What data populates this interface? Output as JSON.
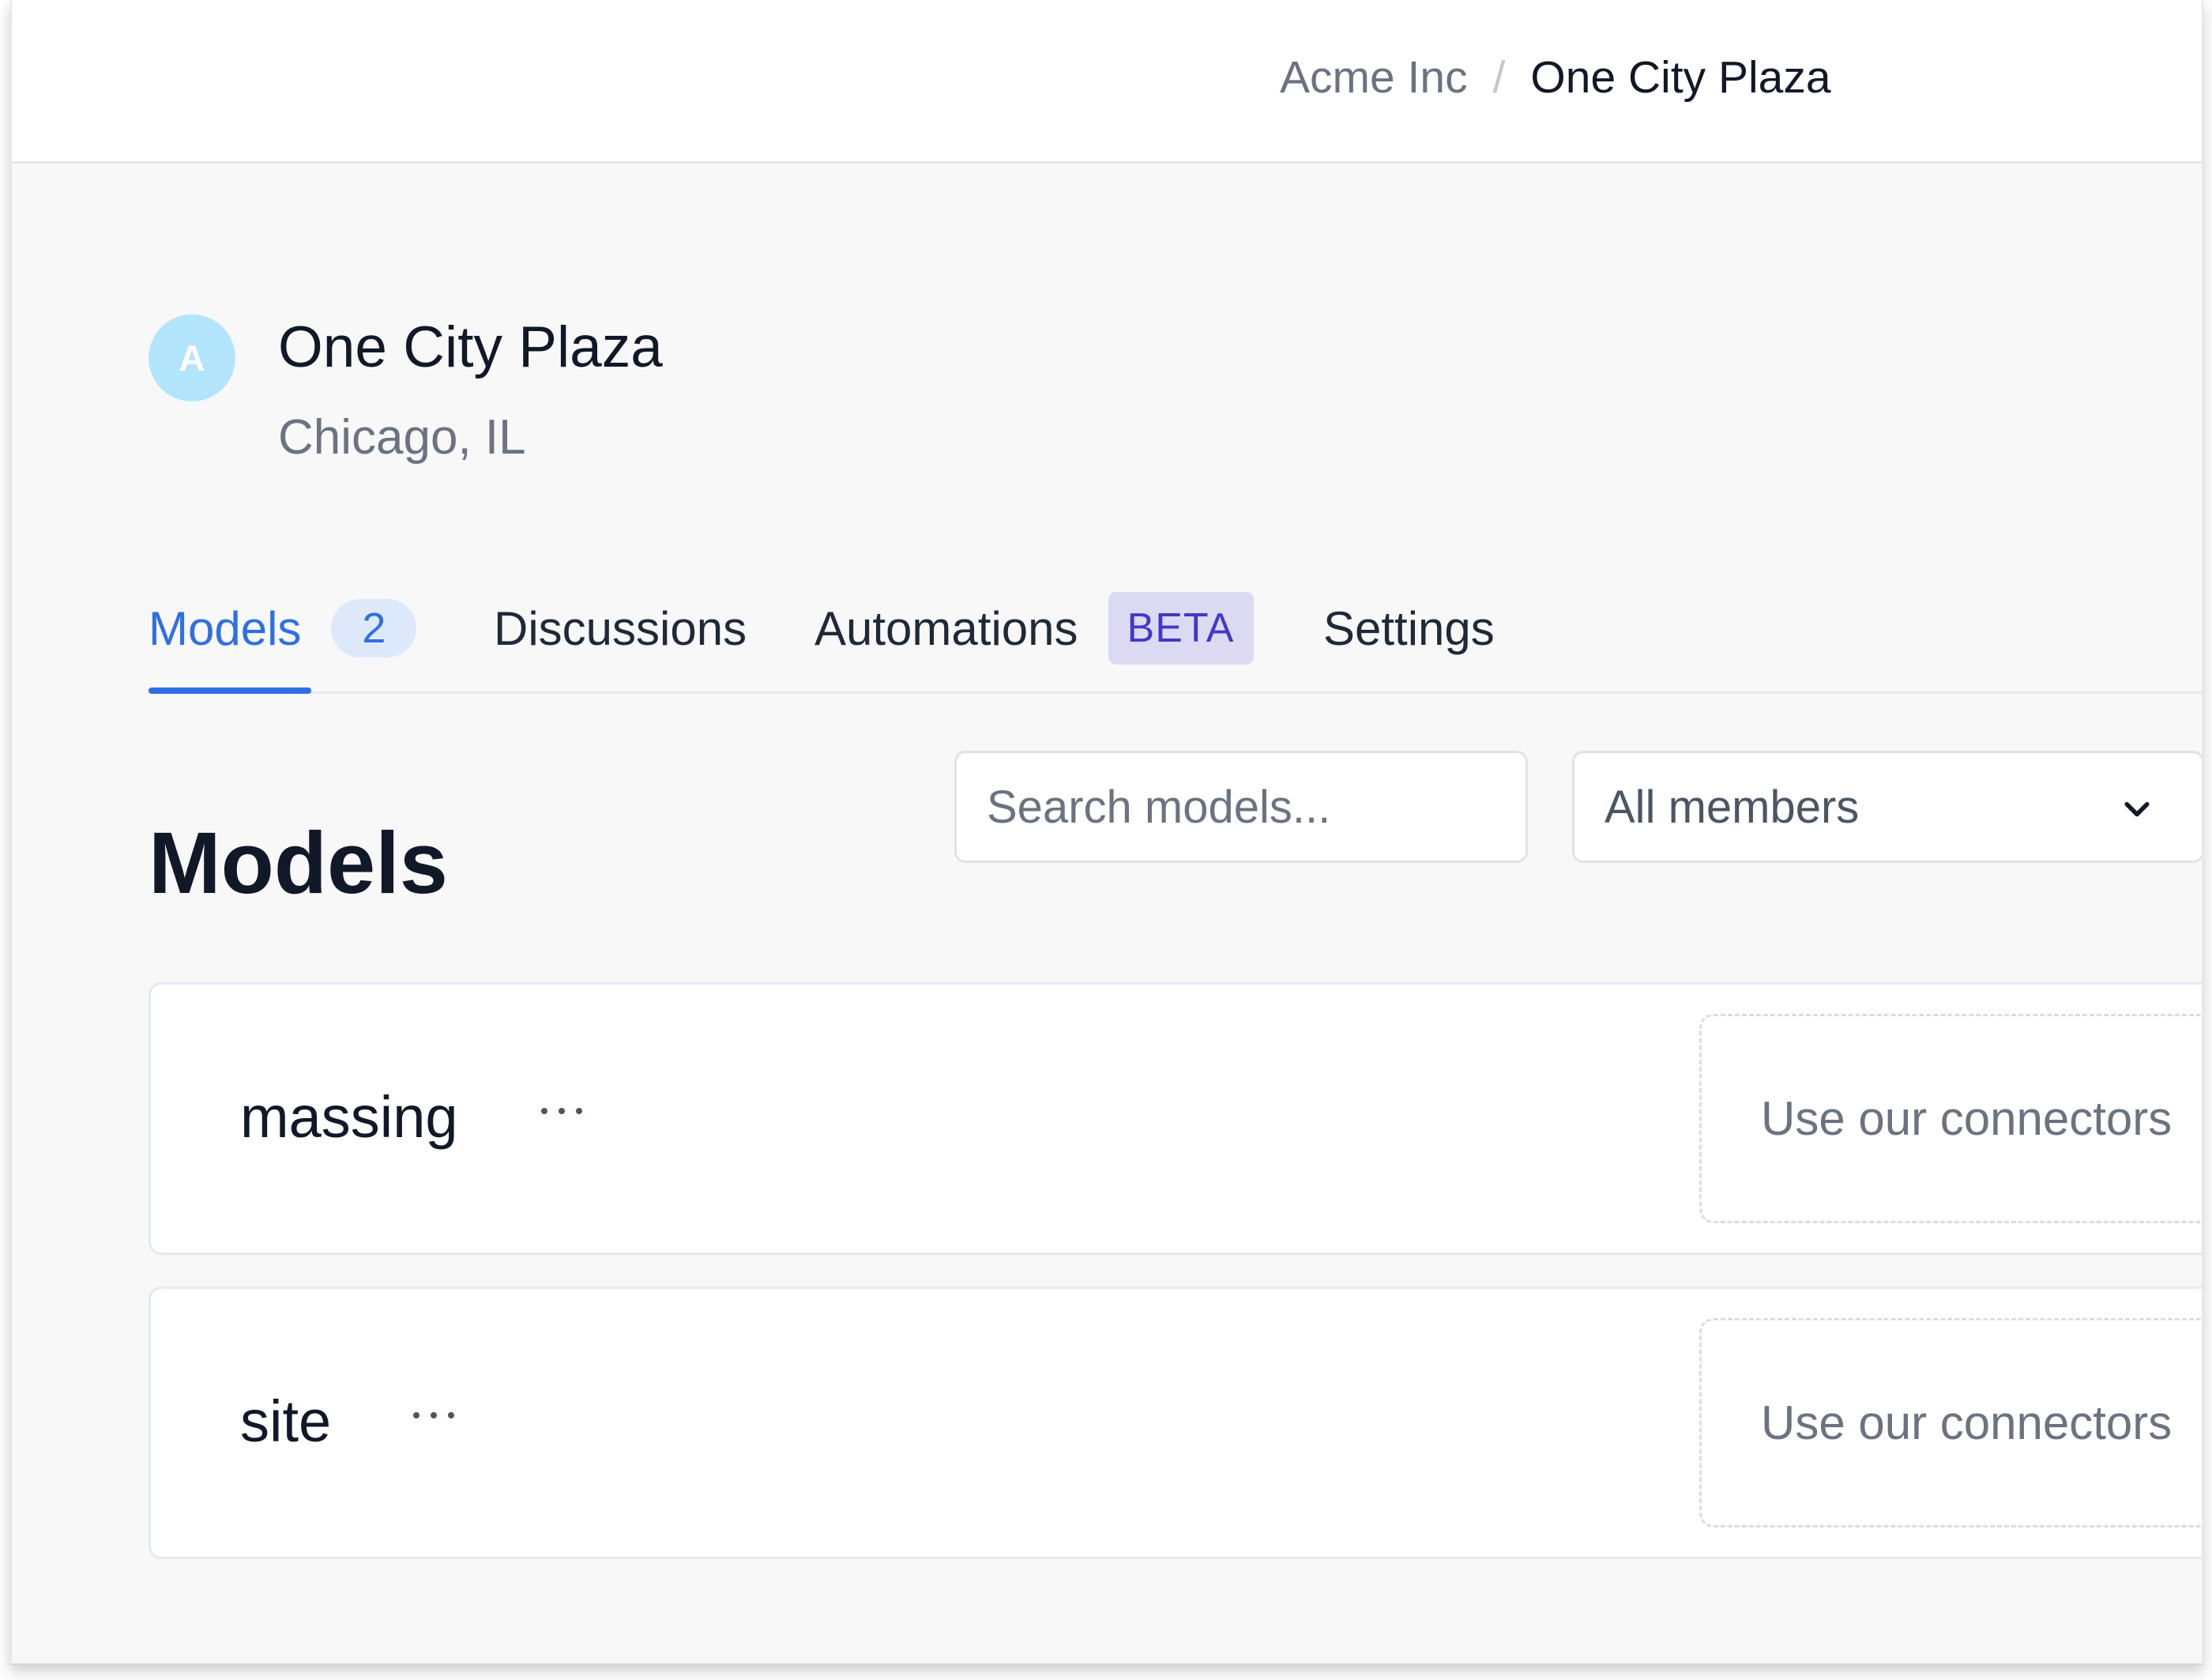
{
  "breadcrumb": {
    "organization": "Acme Inc",
    "separator": "/",
    "current": "One City Plaza"
  },
  "project": {
    "avatar_initial": "A",
    "name": "One City Plaza",
    "location": "Chicago, IL"
  },
  "tabs": [
    {
      "label": "Models",
      "badge": "2",
      "active": true
    },
    {
      "label": "Discussions"
    },
    {
      "label": "Automations",
      "badge": "BETA"
    },
    {
      "label": "Settings"
    }
  ],
  "models_section": {
    "title": "Models",
    "search_placeholder": "Search models...",
    "member_filter": "All members"
  },
  "models": [
    {
      "name": "massing",
      "menu_label": "···",
      "connector_text": "Use our connectors"
    },
    {
      "name": "site",
      "menu_label": "···",
      "connector_text": "Use our connectors"
    }
  ],
  "icons": {
    "member_filter_chevron": "chevron-down-icon",
    "model_menu": "more-horizontal-icon"
  },
  "colors": {
    "accent": "#2f6fe4",
    "badge_background": "#dde9fb",
    "beta_background": "#dcdaf3",
    "beta_text": "#4338ca",
    "avatar": "#b3e5fc"
  }
}
